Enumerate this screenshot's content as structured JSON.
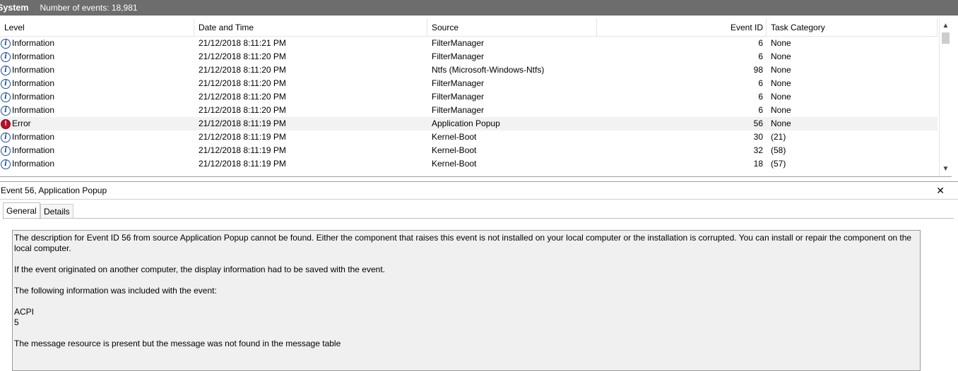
{
  "titlebar": {
    "log_name": "System",
    "event_count": "Number of events: 18,981"
  },
  "table": {
    "columns": [
      "Level",
      "Date and Time",
      "Source",
      "Event ID",
      "Task Category"
    ],
    "rows": [
      {
        "level": "Information",
        "datetime": "21/12/2018 8:11:21 PM",
        "source": "FilterManager",
        "event_id": "6",
        "category": "None",
        "icon": "info-icon"
      },
      {
        "level": "Information",
        "datetime": "21/12/2018 8:11:20 PM",
        "source": "FilterManager",
        "event_id": "6",
        "category": "None",
        "icon": "info-icon"
      },
      {
        "level": "Information",
        "datetime": "21/12/2018 8:11:20 PM",
        "source": "Ntfs (Microsoft-Windows-Ntfs)",
        "event_id": "98",
        "category": "None",
        "icon": "info-icon"
      },
      {
        "level": "Information",
        "datetime": "21/12/2018 8:11:20 PM",
        "source": "FilterManager",
        "event_id": "6",
        "category": "None",
        "icon": "info-icon"
      },
      {
        "level": "Information",
        "datetime": "21/12/2018 8:11:20 PM",
        "source": "FilterManager",
        "event_id": "6",
        "category": "None",
        "icon": "info-icon"
      },
      {
        "level": "Information",
        "datetime": "21/12/2018 8:11:20 PM",
        "source": "FilterManager",
        "event_id": "6",
        "category": "None",
        "icon": "info-icon"
      },
      {
        "level": "Error",
        "datetime": "21/12/2018 8:11:19 PM",
        "source": "Application Popup",
        "event_id": "56",
        "category": "None",
        "icon": "error-icon"
      },
      {
        "level": "Information",
        "datetime": "21/12/2018 8:11:19 PM",
        "source": "Kernel-Boot",
        "event_id": "30",
        "category": "(21)",
        "icon": "info-icon"
      },
      {
        "level": "Information",
        "datetime": "21/12/2018 8:11:19 PM",
        "source": "Kernel-Boot",
        "event_id": "32",
        "category": "(58)",
        "icon": "info-icon"
      },
      {
        "level": "Information",
        "datetime": "21/12/2018 8:11:19 PM",
        "source": "Kernel-Boot",
        "event_id": "18",
        "category": "(57)",
        "icon": "info-icon"
      }
    ]
  },
  "detail": {
    "title": "Event 56, Application Popup",
    "tabs": [
      "General",
      "Details"
    ],
    "description": [
      "The description for Event ID 56 from source Application Popup cannot be found. Either the component that raises this event is not installed on your local computer or the installation is corrupted. You can install or repair the component on the local computer.",
      "If the event originated on another computer, the display information had to be saved with the event.",
      "The following information was included with the event:",
      "ACPI",
      "5",
      "The message resource is present but the message was not found in the message table"
    ]
  },
  "colors": {
    "titlebar": "#6d6d6d",
    "selected_row": "#f2f2f2",
    "error_icon": "#b8102a",
    "info_icon": "#1f4e8c"
  }
}
